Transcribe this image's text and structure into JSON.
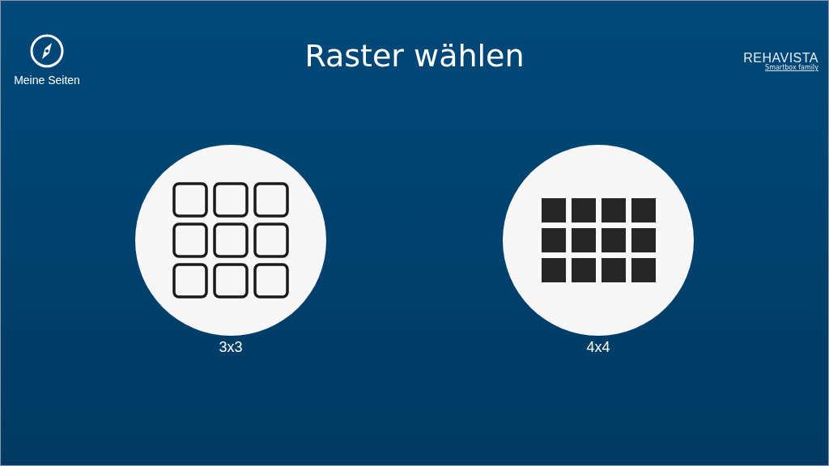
{
  "nav": {
    "label": "Meine Seiten"
  },
  "title": "Raster wählen",
  "logo": {
    "name": "REHAVISTA",
    "tagline": "Smartbox family"
  },
  "options": [
    {
      "label": "3x3",
      "kind": "outlined3"
    },
    {
      "label": "4x4",
      "kind": "filled4"
    }
  ]
}
